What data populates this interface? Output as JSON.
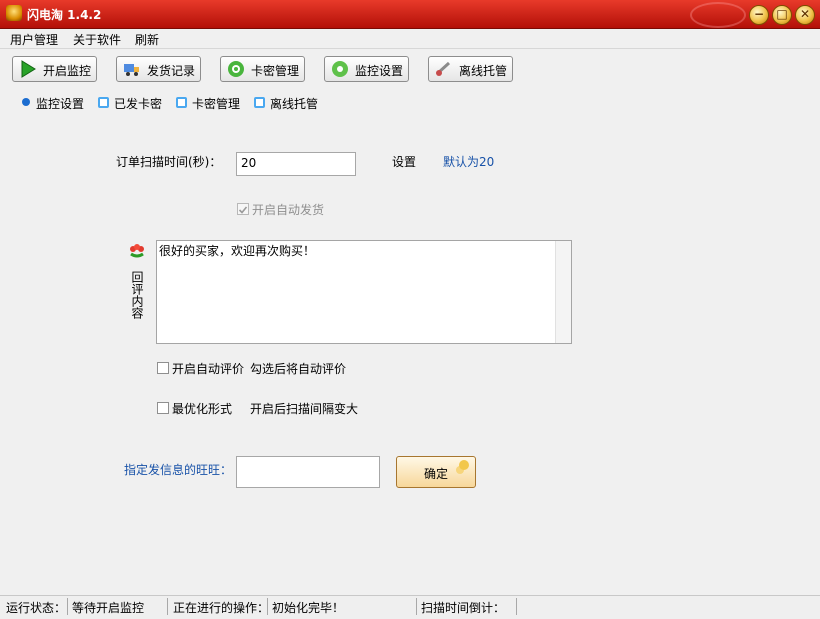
{
  "window": {
    "title": "闪电淘 1.4.2"
  },
  "menu": {
    "items": [
      "用户管理",
      "关于软件",
      "刷新"
    ]
  },
  "toolbar": {
    "buttons": [
      {
        "label": "开启监控",
        "icon": "play-icon"
      },
      {
        "label": "发货记录",
        "icon": "truck-icon"
      },
      {
        "label": "卡密管理",
        "icon": "gear-icon"
      },
      {
        "label": "监控设置",
        "icon": "settings-icon"
      },
      {
        "label": "离线托管",
        "icon": "cloud-icon"
      }
    ]
  },
  "tabs": {
    "items": [
      {
        "label": "监控设置"
      },
      {
        "label": "已发卡密"
      },
      {
        "label": "卡密管理"
      },
      {
        "label": "离线托管"
      }
    ]
  },
  "form": {
    "scan_time_label": "订单扫描时间(秒)：",
    "scan_time_value": "20",
    "set_label": "设置",
    "default_hint": "默认为20",
    "auto_ship_label": "开启自动发货",
    "reply_title": "回评内容",
    "reply_text": "很好的买家，欢迎再次购买！",
    "auto_rate_label": "开启自动评价",
    "auto_rate_hint": "勾选后将自动评价",
    "optimize_label": "最优化形式",
    "optimize_hint": "开启后扫描间隔变大",
    "wangwang_label": "指定发信息的旺旺：",
    "wangwang_value": "",
    "ok_label": "确定"
  },
  "status": {
    "state_label": "运行状态：",
    "state_value": "等待开启监控",
    "operation_label": "正在进行的操作：",
    "operation_value": "初始化完毕！",
    "countdown_label": "扫描时间倒计："
  },
  "colors": {
    "title_bar": "#cc2414",
    "accent_link": "#1852a8",
    "tab_dot": "#1c6dd0"
  }
}
